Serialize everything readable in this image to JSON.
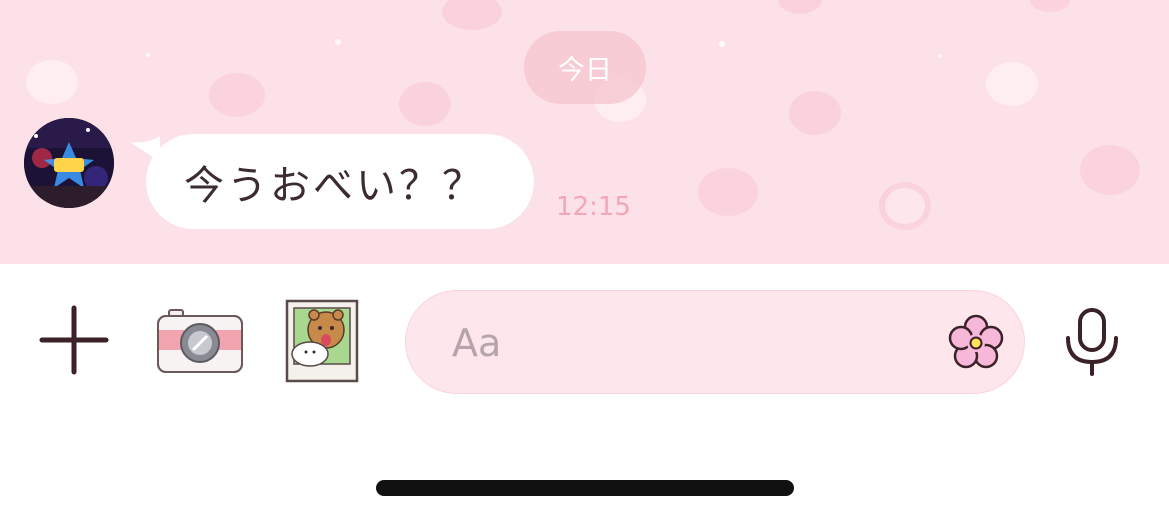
{
  "chat": {
    "date_label": "今日",
    "messages": [
      {
        "text": "今うおべい？？",
        "time": "12:15",
        "direction": "incoming"
      }
    ]
  },
  "composer": {
    "placeholder": "Aa",
    "icons": [
      "plus-icon",
      "camera-icon",
      "photo-icon",
      "flower-sticker-icon",
      "microphone-icon"
    ]
  },
  "colors": {
    "chat_background": "#fde1e8",
    "bubble": "#ffffff",
    "timestamp": "#f2a7b6",
    "input_field": "#fde7ec",
    "icon_dark": "#3a2226"
  }
}
